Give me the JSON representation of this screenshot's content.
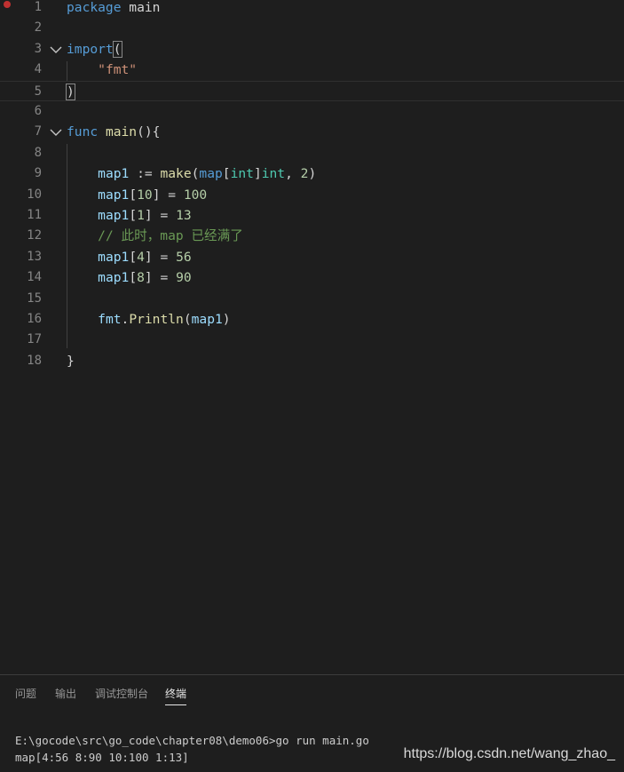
{
  "editor": {
    "lines": [
      {
        "n": "1",
        "tokens": [
          {
            "t": "package",
            "c": "kw"
          },
          {
            "t": " main",
            "c": "plain"
          }
        ]
      },
      {
        "n": "2",
        "tokens": []
      },
      {
        "n": "3",
        "tokens": [
          {
            "t": "import",
            "c": "kw"
          },
          {
            "t": "(",
            "c": "bracket"
          }
        ]
      },
      {
        "n": "4",
        "tokens": [
          {
            "t": "    ",
            "c": "plain"
          },
          {
            "t": "\"fmt\"",
            "c": "str"
          }
        ]
      },
      {
        "n": "5",
        "tokens": [
          {
            "t": ")",
            "c": "bracket"
          }
        ]
      },
      {
        "n": "6",
        "tokens": []
      },
      {
        "n": "7",
        "tokens": [
          {
            "t": "func",
            "c": "kw"
          },
          {
            "t": " ",
            "c": "plain"
          },
          {
            "t": "main",
            "c": "fn"
          },
          {
            "t": "(){",
            "c": "plain"
          }
        ]
      },
      {
        "n": "8",
        "tokens": []
      },
      {
        "n": "9",
        "tokens": [
          {
            "t": "    ",
            "c": "plain"
          },
          {
            "t": "map1",
            "c": "var"
          },
          {
            "t": " := ",
            "c": "plain"
          },
          {
            "t": "make",
            "c": "fn"
          },
          {
            "t": "(",
            "c": "plain"
          },
          {
            "t": "map",
            "c": "kw"
          },
          {
            "t": "[",
            "c": "plain"
          },
          {
            "t": "int",
            "c": "type"
          },
          {
            "t": "]",
            "c": "plain"
          },
          {
            "t": "int",
            "c": "type"
          },
          {
            "t": ", ",
            "c": "plain"
          },
          {
            "t": "2",
            "c": "num"
          },
          {
            "t": ")",
            "c": "plain"
          }
        ]
      },
      {
        "n": "10",
        "tokens": [
          {
            "t": "    ",
            "c": "plain"
          },
          {
            "t": "map1",
            "c": "var"
          },
          {
            "t": "[",
            "c": "plain"
          },
          {
            "t": "10",
            "c": "num"
          },
          {
            "t": "] = ",
            "c": "plain"
          },
          {
            "t": "100",
            "c": "num"
          }
        ]
      },
      {
        "n": "11",
        "tokens": [
          {
            "t": "    ",
            "c": "plain"
          },
          {
            "t": "map1",
            "c": "var"
          },
          {
            "t": "[",
            "c": "plain"
          },
          {
            "t": "1",
            "c": "num"
          },
          {
            "t": "] = ",
            "c": "plain"
          },
          {
            "t": "13",
            "c": "num"
          }
        ]
      },
      {
        "n": "12",
        "tokens": [
          {
            "t": "    ",
            "c": "plain"
          },
          {
            "t": "// 此时，map 已经满了",
            "c": "cmt"
          }
        ]
      },
      {
        "n": "13",
        "tokens": [
          {
            "t": "    ",
            "c": "plain"
          },
          {
            "t": "map1",
            "c": "var"
          },
          {
            "t": "[",
            "c": "plain"
          },
          {
            "t": "4",
            "c": "num"
          },
          {
            "t": "] = ",
            "c": "plain"
          },
          {
            "t": "56",
            "c": "num"
          }
        ]
      },
      {
        "n": "14",
        "tokens": [
          {
            "t": "    ",
            "c": "plain"
          },
          {
            "t": "map1",
            "c": "var"
          },
          {
            "t": "[",
            "c": "plain"
          },
          {
            "t": "8",
            "c": "num"
          },
          {
            "t": "] = ",
            "c": "plain"
          },
          {
            "t": "90",
            "c": "num"
          }
        ]
      },
      {
        "n": "15",
        "tokens": []
      },
      {
        "n": "16",
        "tokens": [
          {
            "t": "    ",
            "c": "plain"
          },
          {
            "t": "fmt",
            "c": "var"
          },
          {
            "t": ".",
            "c": "plain"
          },
          {
            "t": "Println",
            "c": "fn"
          },
          {
            "t": "(",
            "c": "plain"
          },
          {
            "t": "map1",
            "c": "var"
          },
          {
            "t": ")",
            "c": "plain"
          }
        ]
      },
      {
        "n": "17",
        "tokens": []
      },
      {
        "n": "18",
        "tokens": [
          {
            "t": "}",
            "c": "plain"
          }
        ]
      }
    ],
    "folded_lines": [
      "3",
      "7"
    ],
    "breakpoint_line": "1",
    "current_line": "5"
  },
  "panel": {
    "tabs": [
      {
        "label": "问题",
        "active": false
      },
      {
        "label": "输出",
        "active": false
      },
      {
        "label": "调试控制台",
        "active": false
      },
      {
        "label": "终端",
        "active": true
      }
    ],
    "terminal": {
      "command_line": "E:\\gocode\\src\\go_code\\chapter08\\demo06>go run main.go",
      "output_line": "map[4:56 8:90 10:100 1:13]"
    }
  },
  "watermark": "https://blog.csdn.net/wang_zhao_"
}
